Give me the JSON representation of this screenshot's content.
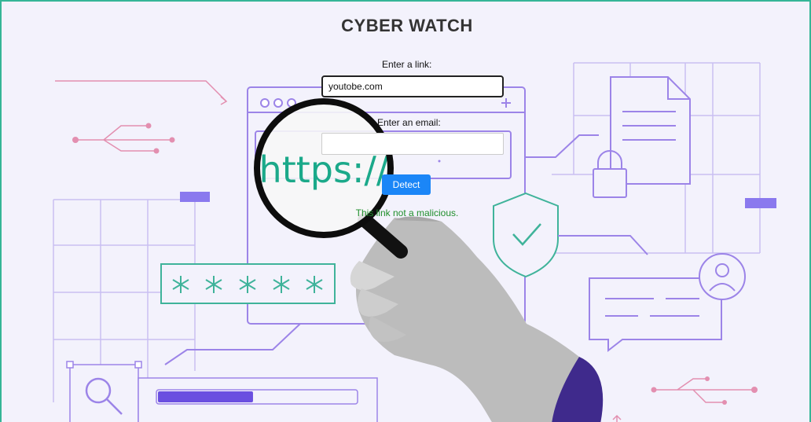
{
  "app": {
    "title": "CYBER WATCH"
  },
  "form": {
    "link_label": "Enter a link:",
    "link_value": "youtobe.com",
    "email_label": "Enter an email:",
    "email_value": "",
    "detect_label": "Detect",
    "result_text": "This link not a malicious."
  },
  "illustration": {
    "url_text": "https://",
    "password_mask": [
      "*",
      "*",
      "*",
      "*",
      "*"
    ],
    "progress": 0.48,
    "icons": [
      "magnifier-icon",
      "padlock-icon",
      "shield-check-icon",
      "document-icon",
      "user-avatar-icon",
      "search-icon"
    ]
  },
  "colors": {
    "background": "#f3f2fc",
    "line_purple": "#9c84e8",
    "accent_teal": "#3fb39a",
    "accent_pink": "#e38fb0",
    "button_blue": "#1b86f7",
    "result_green": "#1f8e2b",
    "frame_border": "#35b597"
  }
}
